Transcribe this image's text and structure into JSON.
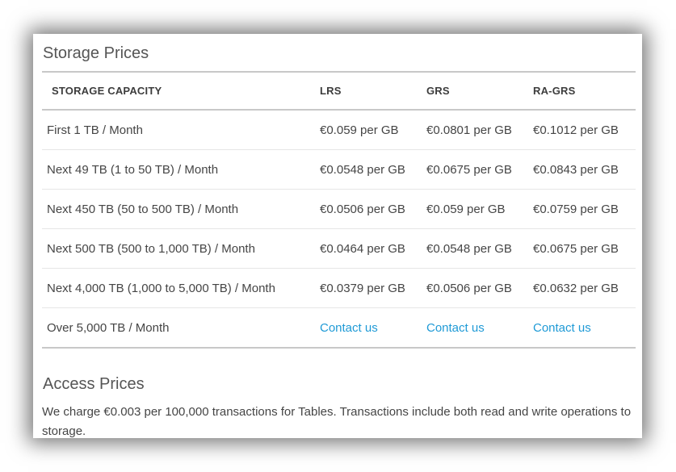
{
  "storage": {
    "title": "Storage Prices",
    "headers": [
      "STORAGE CAPACITY",
      "LRS",
      "GRS",
      "RA-GRS"
    ],
    "rows": [
      [
        "First 1 TB / Month",
        "€0.059 per GB",
        "€0.0801 per GB",
        "€0.1012 per GB"
      ],
      [
        "Next 49 TB (1 to 50 TB) / Month",
        "€0.0548 per GB",
        "€0.0675 per GB",
        "€0.0843 per GB"
      ],
      [
        "Next 450 TB (50 to 500 TB) / Month",
        "€0.0506 per GB",
        "€0.059 per GB",
        "€0.0759 per GB"
      ],
      [
        "Next 500 TB (500 to 1,000 TB) / Month",
        "€0.0464 per GB",
        "€0.0548 per GB",
        "€0.0675 per GB"
      ],
      [
        "Next 4,000 TB (1,000 to 5,000 TB) / Month",
        "€0.0379 per GB",
        "€0.0506 per GB",
        "€0.0632 per GB"
      ],
      [
        "Over 5,000 TB / Month",
        "Contact us",
        "Contact us",
        "Contact us"
      ]
    ]
  },
  "access": {
    "title": "Access Prices",
    "text": "We charge €0.003 per 100,000 transactions for Tables. Transactions include both read and write operations to storage."
  },
  "colors": {
    "link": "#1f9ad6",
    "text": "#454545",
    "border": "#c8c8c8"
  }
}
